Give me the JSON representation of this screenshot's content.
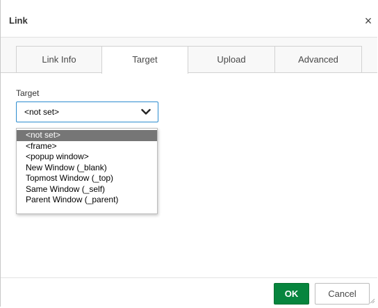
{
  "dialog": {
    "title": "Link",
    "close_symbol": "×"
  },
  "tabs": [
    {
      "label": "Link Info",
      "active": false
    },
    {
      "label": "Target",
      "active": true
    },
    {
      "label": "Upload",
      "active": false
    },
    {
      "label": "Advanced",
      "active": false
    }
  ],
  "target_field": {
    "label": "Target",
    "value": "<not set>",
    "arrow_icon": "chevron-down-icon"
  },
  "dropdown": {
    "options": [
      "<not set>",
      "<frame>",
      "<popup window>",
      "New Window (_blank)",
      "Topmost Window (_top)",
      "Same Window (_self)",
      "Parent Window (_parent)"
    ],
    "selected_index": 0
  },
  "footer": {
    "ok_label": "OK",
    "cancel_label": "Cancel"
  },
  "colors": {
    "ok_bg": "#07853e",
    "focus_border": "#2b8bcf",
    "selected_option_bg": "#767676"
  }
}
